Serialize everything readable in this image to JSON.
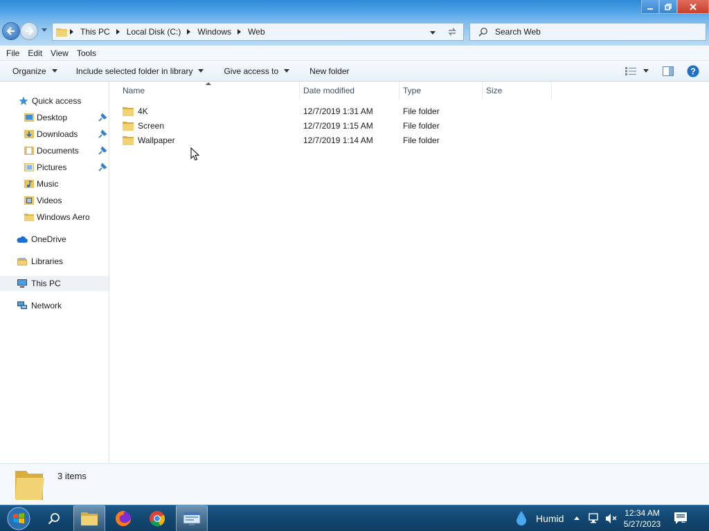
{
  "window": {
    "controls": {
      "minimize": "minimize",
      "restore": "restore",
      "close": "close"
    }
  },
  "address": {
    "crumbs": [
      "This PC",
      "Local Disk (C:)",
      "Windows",
      "Web"
    ]
  },
  "search": {
    "placeholder": "Search Web"
  },
  "menu": {
    "items": [
      "File",
      "Edit",
      "View",
      "Tools"
    ]
  },
  "commands": {
    "organize": "Organize",
    "include_library": "Include selected folder in library",
    "give_access": "Give access to",
    "new_folder": "New folder"
  },
  "navpane": {
    "quick_access": "Quick access",
    "quick_items": [
      {
        "label": "Desktop",
        "icon": "desktop-icon",
        "pinned": true
      },
      {
        "label": "Downloads",
        "icon": "downloads-icon",
        "pinned": true
      },
      {
        "label": "Documents",
        "icon": "documents-icon",
        "pinned": true
      },
      {
        "label": "Pictures",
        "icon": "pictures-icon",
        "pinned": true
      },
      {
        "label": "Music",
        "icon": "music-icon",
        "pinned": false
      },
      {
        "label": "Videos",
        "icon": "videos-icon",
        "pinned": false
      },
      {
        "label": "Windows Aero",
        "icon": "folder-icon",
        "pinned": false
      }
    ],
    "onedrive": "OneDrive",
    "libraries": "Libraries",
    "this_pc": "This PC",
    "network": "Network"
  },
  "columns": {
    "name": "Name",
    "date": "Date modified",
    "type": "Type",
    "size": "Size"
  },
  "files": [
    {
      "name": "4K",
      "date": "12/7/2019 1:31 AM",
      "type": "File folder",
      "size": ""
    },
    {
      "name": "Screen",
      "date": "12/7/2019 1:15 AM",
      "type": "File folder",
      "size": ""
    },
    {
      "name": "Wallpaper",
      "date": "12/7/2019 1:14 AM",
      "type": "File folder",
      "size": ""
    }
  ],
  "details": {
    "count": "3 items"
  },
  "taskbar": {
    "weather": "Humid",
    "time": "12:34 AM",
    "date": "5/27/2023",
    "notifications": "2"
  },
  "colors": {
    "accent": "#2d8ad8",
    "folder": "#e8c25a",
    "taskbar": "#144a75"
  }
}
